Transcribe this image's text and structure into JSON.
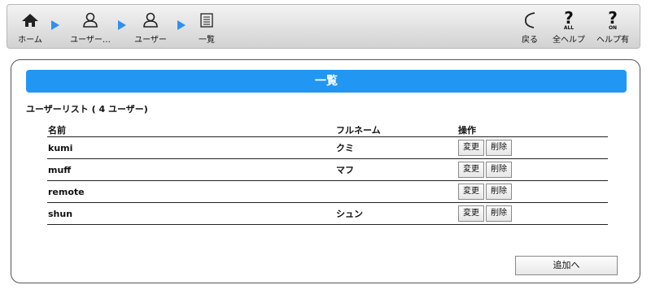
{
  "toolbar": {
    "home": "ホーム",
    "users_crumb": "ユーザー…",
    "user_crumb": "ユーザー",
    "list_crumb": "一覧",
    "back": "戻る",
    "all_help": "全ヘルプ",
    "help_on": "ヘルプ有",
    "all_badge": "ALL",
    "on_badge": "ON"
  },
  "panel": {
    "title": "一覧",
    "caption": "ユーザーリスト ( 4 ユーザー)",
    "columns": {
      "name": "名前",
      "fullname": "フルネーム",
      "ops": "操作"
    },
    "rows": [
      {
        "name": "kumi",
        "fullname": "クミ",
        "edit": "変更",
        "delete": "削除"
      },
      {
        "name": "muff",
        "fullname": "マフ",
        "edit": "変更",
        "delete": "削除"
      },
      {
        "name": "remote",
        "fullname": "",
        "edit": "変更",
        "delete": "削除"
      },
      {
        "name": "shun",
        "fullname": "シュン",
        "edit": "変更",
        "delete": "削除"
      }
    ],
    "add_button": "追加へ"
  },
  "colors": {
    "accent": "#2196f3",
    "arrow": "#2f8ff0"
  }
}
